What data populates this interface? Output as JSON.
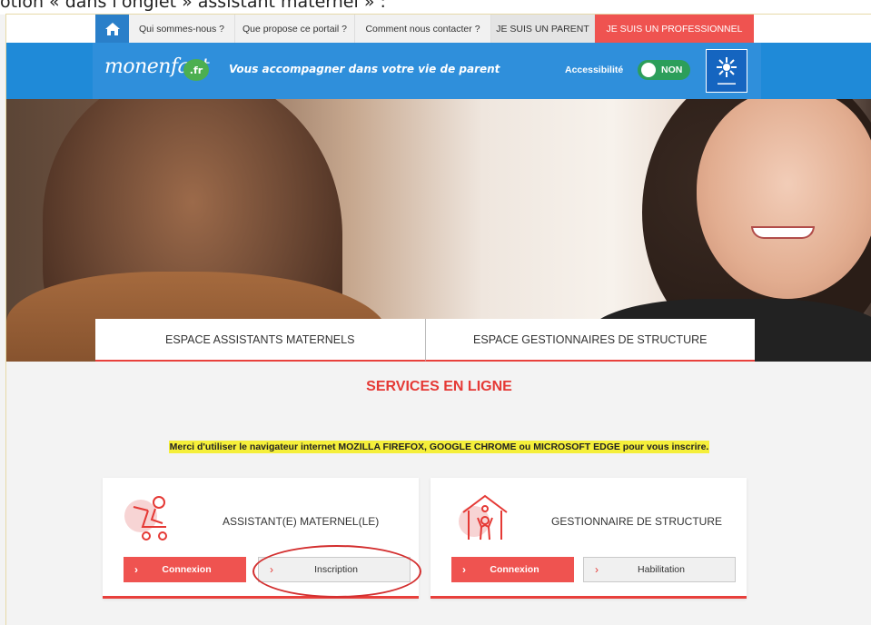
{
  "caption": {
    "text": "otion « dans l'onglet » assistant maternel » :"
  },
  "topnav": {
    "items": [
      {
        "label": "Qui sommes-nous ?"
      },
      {
        "label": "Que propose ce portail ?"
      },
      {
        "label": "Comment nous contacter ?"
      },
      {
        "label": "JE SUIS UN PARENT"
      },
      {
        "label": "JE SUIS UN PROFESSIONNEL"
      }
    ],
    "home_icon": "home-icon",
    "colors": {
      "home_bg": "#2a7fc9",
      "pro_bg": "#ef5350"
    }
  },
  "header": {
    "logo_text": "monenfant",
    "logo_suffix": ".fr",
    "tagline": "Vous accompagner dans votre vie de parent",
    "accessibility_label": "Accessibilité",
    "toggle_value": "NON",
    "partner_logo_icon": "caf-logo-icon",
    "colors": {
      "band": "#1f8ad8",
      "toggle": "#2c9e5a"
    }
  },
  "espace_tabs": [
    {
      "label": "ESPACE ASSISTANTS MATERNELS"
    },
    {
      "label": "ESPACE GESTIONNAIRES DE STRUCTURE"
    }
  ],
  "services": {
    "title": "SERVICES EN LIGNE",
    "notice": "Merci d'utiliser le navigateur internet MOZILLA FIREFOX, GOOGLE CHROME ou MICROSOFT EDGE pour vous inscrire.",
    "title_color": "#e53935",
    "notice_highlight": "#f5ef3a"
  },
  "cards": [
    {
      "title": "ASSISTANT(E) MATERNEL(LE)",
      "icon": "baby-stroller-icon",
      "primary": "Connexion",
      "secondary": "Inscription"
    },
    {
      "title": "GESTIONNAIRE DE STRUCTURE",
      "icon": "childcare-house-icon",
      "primary": "Connexion",
      "secondary": "Habilitation"
    }
  ]
}
